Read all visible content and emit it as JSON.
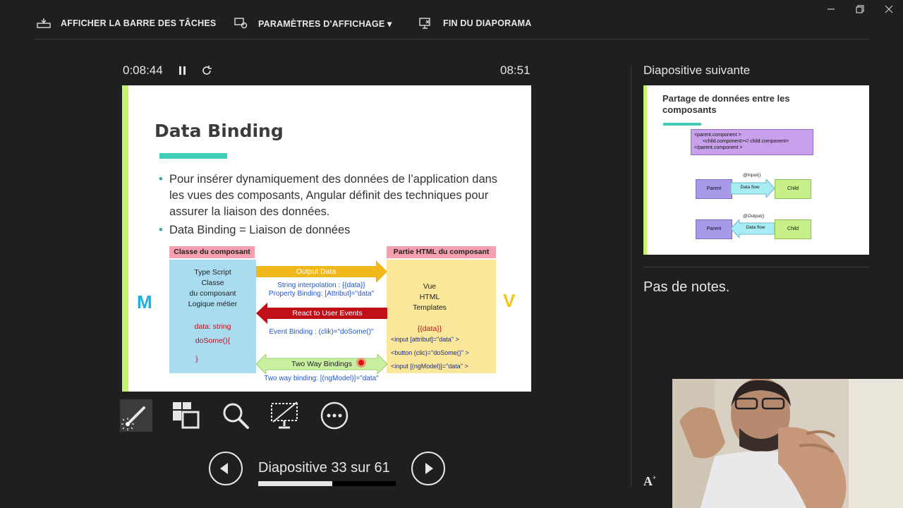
{
  "topbar": {
    "taskbar_label": "AFFICHER LA BARRE DES TÂCHES",
    "display_settings_label": "PARAMÈTRES D'AFFICHAGE ▾",
    "end_show_label": "FIN DU DIAPORAMA"
  },
  "presenter": {
    "elapsed": "0:08:44",
    "clock": "08:51",
    "slide_counter": "Diapositive 33 sur 61",
    "progress_fraction": 0.54
  },
  "slide": {
    "title": "Data Binding",
    "bullets": [
      "Pour insérer dynamiquement des données de l’application dans les vues des composants, Angular définit des techniques  pour assurer la liaison des données.",
      "Data Binding = Liaison de données"
    ],
    "diagram": {
      "left_header": "Classe du composant",
      "right_header": "Partie HTML du composant",
      "left_lines": [
        "Type Script",
        "Classe",
        "du composant",
        "Logique métier"
      ],
      "left_code1": "data: string",
      "left_code2": "doSome(){",
      "left_code3": "}",
      "right_lines": [
        "Vue",
        "HTML",
        "Templates"
      ],
      "right_data": "{{data}}",
      "right_code1": "<input [attribut]=\"data\" >",
      "right_code2": "<button (clic)=\"doSome()\" >",
      "right_code3": "<input [(ngModel)]=\"data\" >",
      "output_label": "Output Data",
      "interp_line": "String interpolation : {{data}}",
      "prop_line": "Property Binding: [Attribut]=\"data\"",
      "react_label": "React to User Events",
      "event_line": "Event Binding : (clik)=\"doSome()\"",
      "twoway_label": "Two Way Bindings",
      "twoway_line": "Two way binding: [(ngModel)]=\"data\"",
      "m_letter": "M",
      "v_letter": "V"
    },
    "colors": {
      "accent_bar": "#c6f26e",
      "teal": "#3fcfb6",
      "yellow": "#f5c518",
      "red": "#c0101a",
      "green": "#c8f0a0"
    }
  },
  "next_slide": {
    "label": "Diapositive suivante",
    "title": "Partage de données entre les composants",
    "code1": "<parent.component >",
    "code2": "<child.component></ child.component>",
    "code3": "</parent.component >",
    "input_label": "@Input()",
    "output_label": "@Output()",
    "parent": "Parent",
    "child": "Child",
    "flow": "Data flow"
  },
  "notes": {
    "text": "Pas de notes.",
    "font_button": "A"
  },
  "icons": [
    "laser-pen-icon",
    "see-all-slides-icon",
    "zoom-icon",
    "black-screen-icon",
    "more-options-icon"
  ]
}
